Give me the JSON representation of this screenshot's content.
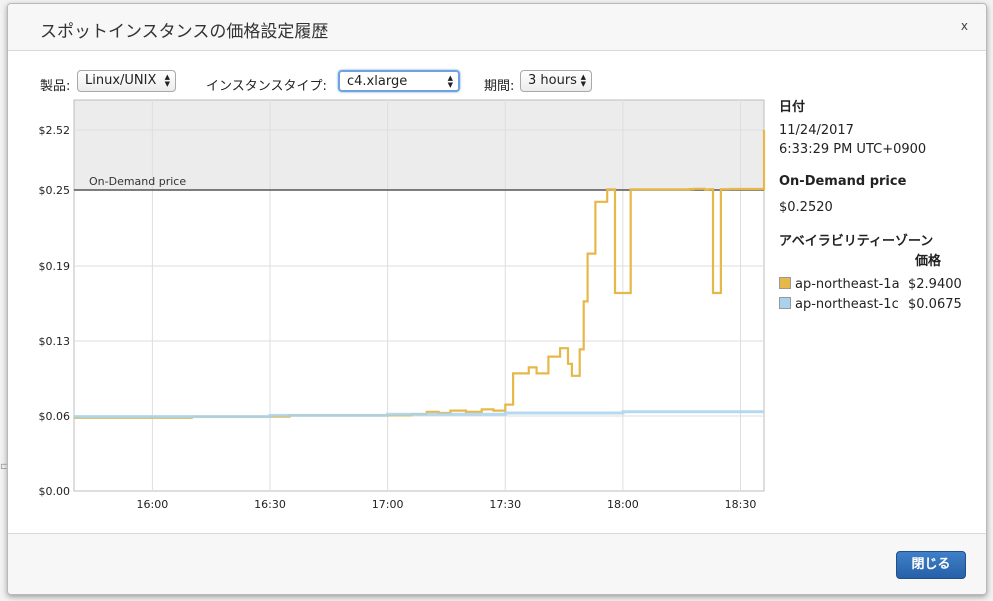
{
  "dialog": {
    "title": "スポットインスタンスの価格設定履歴",
    "close_glyph": "x",
    "close_button": "閉じる"
  },
  "filters": {
    "product_label": "製品:",
    "product_value": "Linux/UNIX",
    "instance_type_label": "インスタンスタイプ:",
    "instance_type_value": "c4.xlarge",
    "period_label": "期間:",
    "period_value": "3 hours"
  },
  "details": {
    "date_heading": "日付",
    "date": "11/24/2017",
    "time": "6:33:29 PM UTC+0900",
    "ondemand_heading": "On-Demand price",
    "ondemand_value": "$0.2520",
    "az_heading": "アベイラビリティーゾーン",
    "price_heading": "価格",
    "zones": [
      {
        "name": "ap-northeast-1a",
        "price": "$2.9400",
        "color": "#e6b84a"
      },
      {
        "name": "ap-northeast-1c",
        "price": "$0.0675",
        "color": "#a9d2ee"
      }
    ]
  },
  "chart_data": {
    "type": "line",
    "y_tick_labels": [
      "$0.00",
      "$0.06",
      "$0.13",
      "$0.19",
      "$0.25",
      "$2.52"
    ],
    "x_tick_labels": [
      "16:00",
      "16:30",
      "17:00",
      "17:30",
      "18:00",
      "18:30"
    ],
    "x_range": [
      "15:40",
      "18:36"
    ],
    "reference_line": {
      "label": "On-Demand price",
      "value": 0.252
    },
    "scale_note": "non-linear axis: 0 to 0.25 linear, above 0.25 compressed up to 2.52",
    "grid": true,
    "series": [
      {
        "name": "ap-northeast-1a",
        "color": "#e6b84a",
        "x": [
          "15:40",
          "16:10",
          "16:35",
          "17:06",
          "17:10",
          "17:13",
          "17:16",
          "17:20",
          "17:24",
          "17:27",
          "17:30",
          "17:32",
          "17:36",
          "17:38",
          "17:41",
          "17:44",
          "17:46",
          "17:47",
          "17:49",
          "17:50",
          "17:51",
          "17:53",
          "17:56",
          "17:58",
          "18:02",
          "18:17",
          "18:18",
          "18:21",
          "18:22",
          "18:23",
          "18:25",
          "18:27",
          "18:36"
        ],
        "values": [
          0.061,
          0.062,
          0.063,
          0.064,
          0.066,
          0.065,
          0.067,
          0.066,
          0.068,
          0.067,
          0.072,
          0.098,
          0.103,
          0.098,
          0.112,
          0.119,
          0.106,
          0.096,
          0.118,
          0.158,
          0.198,
          0.242,
          0.275,
          0.165,
          0.275,
          0.286,
          0.298,
          0.265,
          0.282,
          0.165,
          0.282,
          0.29,
          2.52
        ]
      },
      {
        "name": "ap-northeast-1c",
        "color": "#a9d2ee",
        "x": [
          "15:40",
          "16:30",
          "17:00",
          "17:30",
          "18:00",
          "18:36"
        ],
        "values": [
          0.062,
          0.063,
          0.064,
          0.065,
          0.066,
          0.066
        ]
      }
    ]
  }
}
